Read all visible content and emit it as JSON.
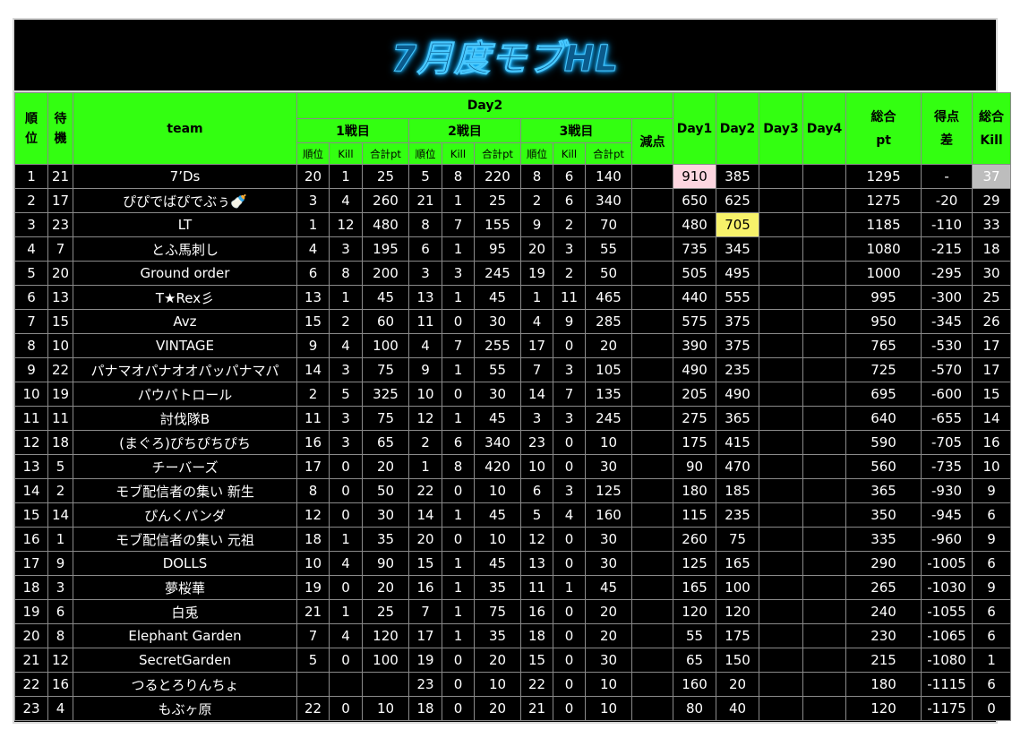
{
  "title": "7月度モブHL",
  "headers": {
    "rank": "順位",
    "wait": "待機",
    "team": "team",
    "day2": "Day2",
    "battle1": "1戦目",
    "battle2": "2戦目",
    "battle3": "3戦目",
    "sub_rank": "順位",
    "sub_kill": "Kill",
    "sub_total": "合計pt",
    "deduction": "減点",
    "day1": "Day1",
    "day2_col": "Day2",
    "day3": "Day3",
    "day4": "Day4",
    "total_pt": "総合pt",
    "diff": "得点差",
    "total_kill": "総合Kill"
  },
  "rows": [
    {
      "rank": "1",
      "wait": "21",
      "team": "7’Ds",
      "b1r": "20",
      "b1k": "1",
      "b1p": "25",
      "b2r": "5",
      "b2k": "8",
      "b2p": "220",
      "b3r": "8",
      "b3k": "6",
      "b3p": "140",
      "ded": "",
      "d1": "910",
      "d2": "385",
      "d3": "",
      "d4": "",
      "total": "1295",
      "diff": "-",
      "kill": "37"
    },
    {
      "rank": "2",
      "wait": "17",
      "team": "ぴぴでばぴでぶぅ🍼",
      "b1r": "3",
      "b1k": "4",
      "b1p": "260",
      "b2r": "21",
      "b2k": "1",
      "b2p": "25",
      "b3r": "2",
      "b3k": "6",
      "b3p": "340",
      "ded": "",
      "d1": "650",
      "d2": "625",
      "d3": "",
      "d4": "",
      "total": "1275",
      "diff": "-20",
      "kill": "29"
    },
    {
      "rank": "3",
      "wait": "23",
      "team": "LT",
      "b1r": "1",
      "b1k": "12",
      "b1p": "480",
      "b2r": "8",
      "b2k": "7",
      "b2p": "155",
      "b3r": "9",
      "b3k": "2",
      "b3p": "70",
      "ded": "",
      "d1": "480",
      "d2": "705",
      "d3": "",
      "d4": "",
      "total": "1185",
      "diff": "-110",
      "kill": "33"
    },
    {
      "rank": "4",
      "wait": "7",
      "team": "とふ馬刺し",
      "b1r": "4",
      "b1k": "3",
      "b1p": "195",
      "b2r": "6",
      "b2k": "1",
      "b2p": "95",
      "b3r": "20",
      "b3k": "3",
      "b3p": "55",
      "ded": "",
      "d1": "735",
      "d2": "345",
      "d3": "",
      "d4": "",
      "total": "1080",
      "diff": "-215",
      "kill": "18"
    },
    {
      "rank": "5",
      "wait": "20",
      "team": "Ground order",
      "b1r": "6",
      "b1k": "8",
      "b1p": "200",
      "b2r": "3",
      "b2k": "3",
      "b2p": "245",
      "b3r": "19",
      "b3k": "2",
      "b3p": "50",
      "ded": "",
      "d1": "505",
      "d2": "495",
      "d3": "",
      "d4": "",
      "total": "1000",
      "diff": "-295",
      "kill": "30"
    },
    {
      "rank": "6",
      "wait": "13",
      "team": "T★Rex彡",
      "b1r": "13",
      "b1k": "1",
      "b1p": "45",
      "b2r": "13",
      "b2k": "1",
      "b2p": "45",
      "b3r": "1",
      "b3k": "11",
      "b3p": "465",
      "ded": "",
      "d1": "440",
      "d2": "555",
      "d3": "",
      "d4": "",
      "total": "995",
      "diff": "-300",
      "kill": "25"
    },
    {
      "rank": "7",
      "wait": "15",
      "team": "Avz",
      "b1r": "15",
      "b1k": "2",
      "b1p": "60",
      "b2r": "11",
      "b2k": "0",
      "b2p": "30",
      "b3r": "4",
      "b3k": "9",
      "b3p": "285",
      "ded": "",
      "d1": "575",
      "d2": "375",
      "d3": "",
      "d4": "",
      "total": "950",
      "diff": "-345",
      "kill": "26"
    },
    {
      "rank": "8",
      "wait": "10",
      "team": "VINTAGE",
      "b1r": "9",
      "b1k": "4",
      "b1p": "100",
      "b2r": "4",
      "b2k": "7",
      "b2p": "255",
      "b3r": "17",
      "b3k": "0",
      "b3p": "20",
      "ded": "",
      "d1": "390",
      "d2": "375",
      "d3": "",
      "d4": "",
      "total": "765",
      "diff": "-530",
      "kill": "17"
    },
    {
      "rank": "9",
      "wait": "22",
      "team": "パナマオパナオオパッパナマパ",
      "b1r": "14",
      "b1k": "3",
      "b1p": "75",
      "b2r": "9",
      "b2k": "1",
      "b2p": "55",
      "b3r": "7",
      "b3k": "3",
      "b3p": "105",
      "ded": "",
      "d1": "490",
      "d2": "235",
      "d3": "",
      "d4": "",
      "total": "725",
      "diff": "-570",
      "kill": "17"
    },
    {
      "rank": "10",
      "wait": "19",
      "team": "パウパトロール",
      "b1r": "2",
      "b1k": "5",
      "b1p": "325",
      "b2r": "10",
      "b2k": "0",
      "b2p": "30",
      "b3r": "14",
      "b3k": "7",
      "b3p": "135",
      "ded": "",
      "d1": "205",
      "d2": "490",
      "d3": "",
      "d4": "",
      "total": "695",
      "diff": "-600",
      "kill": "15"
    },
    {
      "rank": "11",
      "wait": "11",
      "team": "討伐隊B",
      "b1r": "11",
      "b1k": "3",
      "b1p": "75",
      "b2r": "12",
      "b2k": "1",
      "b2p": "45",
      "b3r": "3",
      "b3k": "3",
      "b3p": "245",
      "ded": "",
      "d1": "275",
      "d2": "365",
      "d3": "",
      "d4": "",
      "total": "640",
      "diff": "-655",
      "kill": "14"
    },
    {
      "rank": "12",
      "wait": "18",
      "team": "(まぐろ)ぴちぴちぴち",
      "b1r": "16",
      "b1k": "3",
      "b1p": "65",
      "b2r": "2",
      "b2k": "6",
      "b2p": "340",
      "b3r": "23",
      "b3k": "0",
      "b3p": "10",
      "ded": "",
      "d1": "175",
      "d2": "415",
      "d3": "",
      "d4": "",
      "total": "590",
      "diff": "-705",
      "kill": "16"
    },
    {
      "rank": "13",
      "wait": "5",
      "team": "チーバーズ",
      "b1r": "17",
      "b1k": "0",
      "b1p": "20",
      "b2r": "1",
      "b2k": "8",
      "b2p": "420",
      "b3r": "10",
      "b3k": "0",
      "b3p": "30",
      "ded": "",
      "d1": "90",
      "d2": "470",
      "d3": "",
      "d4": "",
      "total": "560",
      "diff": "-735",
      "kill": "10"
    },
    {
      "rank": "14",
      "wait": "2",
      "team": "モブ配信者の集い 新生",
      "b1r": "8",
      "b1k": "0",
      "b1p": "50",
      "b2r": "22",
      "b2k": "0",
      "b2p": "10",
      "b3r": "6",
      "b3k": "3",
      "b3p": "125",
      "ded": "",
      "d1": "180",
      "d2": "185",
      "d3": "",
      "d4": "",
      "total": "365",
      "diff": "-930",
      "kill": "9"
    },
    {
      "rank": "15",
      "wait": "14",
      "team": "ぴんくパンダ",
      "b1r": "12",
      "b1k": "0",
      "b1p": "30",
      "b2r": "14",
      "b2k": "1",
      "b2p": "45",
      "b3r": "5",
      "b3k": "4",
      "b3p": "160",
      "ded": "",
      "d1": "115",
      "d2": "235",
      "d3": "",
      "d4": "",
      "total": "350",
      "diff": "-945",
      "kill": "6"
    },
    {
      "rank": "16",
      "wait": "1",
      "team": "モブ配信者の集い 元祖",
      "b1r": "18",
      "b1k": "1",
      "b1p": "35",
      "b2r": "20",
      "b2k": "0",
      "b2p": "10",
      "b3r": "12",
      "b3k": "0",
      "b3p": "30",
      "ded": "",
      "d1": "260",
      "d2": "75",
      "d3": "",
      "d4": "",
      "total": "335",
      "diff": "-960",
      "kill": "9"
    },
    {
      "rank": "17",
      "wait": "9",
      "team": "DOLLS",
      "b1r": "10",
      "b1k": "4",
      "b1p": "90",
      "b2r": "15",
      "b2k": "1",
      "b2p": "45",
      "b3r": "13",
      "b3k": "0",
      "b3p": "30",
      "ded": "",
      "d1": "125",
      "d2": "165",
      "d3": "",
      "d4": "",
      "total": "290",
      "diff": "-1005",
      "kill": "6"
    },
    {
      "rank": "18",
      "wait": "3",
      "team": "夢桜華",
      "b1r": "19",
      "b1k": "0",
      "b1p": "20",
      "b2r": "16",
      "b2k": "1",
      "b2p": "35",
      "b3r": "11",
      "b3k": "1",
      "b3p": "45",
      "ded": "",
      "d1": "165",
      "d2": "100",
      "d3": "",
      "d4": "",
      "total": "265",
      "diff": "-1030",
      "kill": "9"
    },
    {
      "rank": "19",
      "wait": "6",
      "team": "白兎",
      "b1r": "21",
      "b1k": "1",
      "b1p": "25",
      "b2r": "7",
      "b2k": "1",
      "b2p": "75",
      "b3r": "16",
      "b3k": "0",
      "b3p": "20",
      "ded": "",
      "d1": "120",
      "d2": "120",
      "d3": "",
      "d4": "",
      "total": "240",
      "diff": "-1055",
      "kill": "6"
    },
    {
      "rank": "20",
      "wait": "8",
      "team": "Elephant Garden",
      "b1r": "7",
      "b1k": "4",
      "b1p": "120",
      "b2r": "17",
      "b2k": "1",
      "b2p": "35",
      "b3r": "18",
      "b3k": "0",
      "b3p": "20",
      "ded": "",
      "d1": "55",
      "d2": "175",
      "d3": "",
      "d4": "",
      "total": "230",
      "diff": "-1065",
      "kill": "6"
    },
    {
      "rank": "21",
      "wait": "12",
      "team": "SecretGarden",
      "b1r": "5",
      "b1k": "0",
      "b1p": "100",
      "b2r": "19",
      "b2k": "0",
      "b2p": "20",
      "b3r": "15",
      "b3k": "0",
      "b3p": "30",
      "ded": "",
      "d1": "65",
      "d2": "150",
      "d3": "",
      "d4": "",
      "total": "215",
      "diff": "-1080",
      "kill": "1"
    },
    {
      "rank": "22",
      "wait": "16",
      "team": "つるとろりんちょ",
      "b1r": "",
      "b1k": "",
      "b1p": "",
      "b2r": "23",
      "b2k": "0",
      "b2p": "10",
      "b3r": "22",
      "b3k": "0",
      "b3p": "10",
      "ded": "",
      "d1": "160",
      "d2": "20",
      "d3": "",
      "d4": "",
      "total": "180",
      "diff": "-1115",
      "kill": "6"
    },
    {
      "rank": "23",
      "wait": "4",
      "team": "もぶヶ原",
      "b1r": "22",
      "b1k": "0",
      "b1p": "10",
      "b2r": "18",
      "b2k": "0",
      "b2p": "20",
      "b3r": "21",
      "b3k": "0",
      "b3p": "10",
      "ded": "",
      "d1": "80",
      "d2": "40",
      "d3": "",
      "d4": "",
      "total": "120",
      "diff": "-1175",
      "kill": "0"
    }
  ],
  "highlights": {
    "pink": "#fcd6e0",
    "yellow": "#f7f26a",
    "gray": "#bdbdbd",
    "header_green": "#33ff11",
    "title_glow": "#1fb6ff"
  }
}
